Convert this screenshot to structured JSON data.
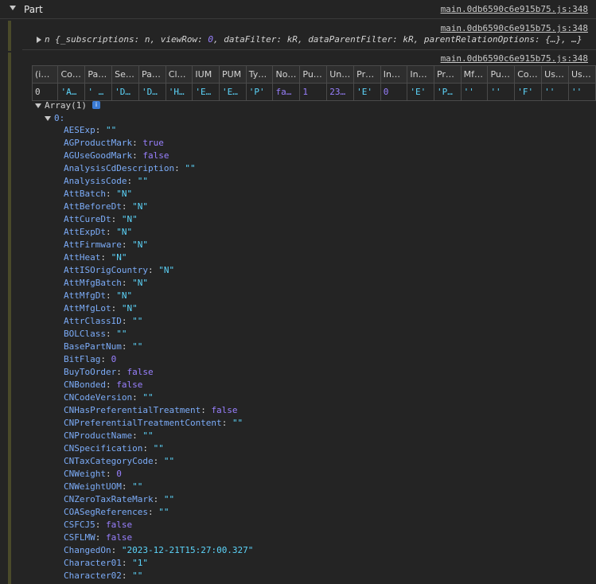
{
  "group": {
    "title": "Part",
    "source": "main.0db6590c6e915b75.js:348"
  },
  "message1": {
    "source": "main.0db6590c6e915b75.js:348",
    "summary_prefix": "n {",
    "summary_items": [
      {
        "key": "_subscriptions",
        "value": "n"
      },
      {
        "key": "viewRow",
        "value": "0"
      },
      {
        "key": "dataFilter",
        "value": "kR"
      },
      {
        "key": "dataParentFilter",
        "value": "kR"
      },
      {
        "key": "parentRelationOptions",
        "value": "{…}"
      }
    ],
    "summary_suffix": "…}"
  },
  "message2": {
    "source": "main.0db6590c6e915b75.js:348",
    "table": {
      "headers": [
        "(i…",
        "Co…",
        "Pa…",
        "Se…",
        "Pa…",
        "Cl…",
        "IUM",
        "PUM",
        "Ty…",
        "No…",
        "Pu…",
        "Un…",
        "Pr…",
        "In…",
        "In…",
        "Pr…",
        "Mf…",
        "Pu…",
        "Co…",
        "Us…",
        "Us…"
      ],
      "rows": [
        [
          {
            "v": "0",
            "t": "plain"
          },
          {
            "v": "'A…",
            "t": "str"
          },
          {
            "v": "' …",
            "t": "str"
          },
          {
            "v": "'D…",
            "t": "str"
          },
          {
            "v": "'D…",
            "t": "str"
          },
          {
            "v": "'H…",
            "t": "str"
          },
          {
            "v": "'E…",
            "t": "str"
          },
          {
            "v": "'E…",
            "t": "str"
          },
          {
            "v": "'P'",
            "t": "str"
          },
          {
            "v": "fa…",
            "t": "bool"
          },
          {
            "v": "1",
            "t": "num"
          },
          {
            "v": "23…",
            "t": "num"
          },
          {
            "v": "'E'",
            "t": "str"
          },
          {
            "v": "0",
            "t": "num"
          },
          {
            "v": "'E'",
            "t": "str"
          },
          {
            "v": "'P…",
            "t": "str"
          },
          {
            "v": "''",
            "t": "str"
          },
          {
            "v": "''",
            "t": "str"
          },
          {
            "v": "'F'",
            "t": "str"
          },
          {
            "v": "''",
            "t": "str"
          },
          {
            "v": "''",
            "t": "str"
          }
        ]
      ]
    },
    "array_label": "Array(1)",
    "info_badge": "i",
    "index_label": "0:",
    "properties": [
      {
        "key": "AESExp",
        "value": "\"\"",
        "type": "str"
      },
      {
        "key": "AGProductMark",
        "value": "true",
        "type": "bool"
      },
      {
        "key": "AGUseGoodMark",
        "value": "false",
        "type": "bool"
      },
      {
        "key": "AnalysisCdDescription",
        "value": "\"\"",
        "type": "str"
      },
      {
        "key": "AnalysisCode",
        "value": "\"\"",
        "type": "str"
      },
      {
        "key": "AttBatch",
        "value": "\"N\"",
        "type": "str"
      },
      {
        "key": "AttBeforeDt",
        "value": "\"N\"",
        "type": "str"
      },
      {
        "key": "AttCureDt",
        "value": "\"N\"",
        "type": "str"
      },
      {
        "key": "AttExpDt",
        "value": "\"N\"",
        "type": "str"
      },
      {
        "key": "AttFirmware",
        "value": "\"N\"",
        "type": "str"
      },
      {
        "key": "AttHeat",
        "value": "\"N\"",
        "type": "str"
      },
      {
        "key": "AttISOrigCountry",
        "value": "\"N\"",
        "type": "str"
      },
      {
        "key": "AttMfgBatch",
        "value": "\"N\"",
        "type": "str"
      },
      {
        "key": "AttMfgDt",
        "value": "\"N\"",
        "type": "str"
      },
      {
        "key": "AttMfgLot",
        "value": "\"N\"",
        "type": "str"
      },
      {
        "key": "AttrClassID",
        "value": "\"\"",
        "type": "str"
      },
      {
        "key": "BOLClass",
        "value": "\"\"",
        "type": "str"
      },
      {
        "key": "BasePartNum",
        "value": "\"\"",
        "type": "str"
      },
      {
        "key": "BitFlag",
        "value": "0",
        "type": "num"
      },
      {
        "key": "BuyToOrder",
        "value": "false",
        "type": "bool"
      },
      {
        "key": "CNBonded",
        "value": "false",
        "type": "bool"
      },
      {
        "key": "CNCodeVersion",
        "value": "\"\"",
        "type": "str"
      },
      {
        "key": "CNHasPreferentialTreatment",
        "value": "false",
        "type": "bool"
      },
      {
        "key": "CNPreferentialTreatmentContent",
        "value": "\"\"",
        "type": "str"
      },
      {
        "key": "CNProductName",
        "value": "\"\"",
        "type": "str"
      },
      {
        "key": "CNSpecification",
        "value": "\"\"",
        "type": "str"
      },
      {
        "key": "CNTaxCategoryCode",
        "value": "\"\"",
        "type": "str"
      },
      {
        "key": "CNWeight",
        "value": "0",
        "type": "num"
      },
      {
        "key": "CNWeightUOM",
        "value": "\"\"",
        "type": "str"
      },
      {
        "key": "CNZeroTaxRateMark",
        "value": "\"\"",
        "type": "str"
      },
      {
        "key": "COASegReferences",
        "value": "\"\"",
        "type": "str"
      },
      {
        "key": "CSFCJ5",
        "value": "false",
        "type": "bool"
      },
      {
        "key": "CSFLMW",
        "value": "false",
        "type": "bool"
      },
      {
        "key": "ChangedOn",
        "value": "\"2023-12-21T15:27:00.327\"",
        "type": "str"
      },
      {
        "key": "Character01",
        "value": "\"1\"",
        "type": "str"
      },
      {
        "key": "Character02",
        "value": "\"\"",
        "type": "str"
      }
    ]
  }
}
